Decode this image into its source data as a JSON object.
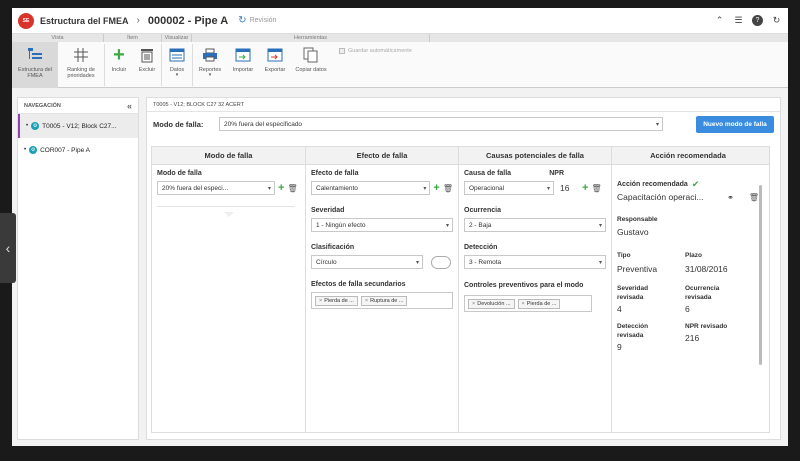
{
  "header": {
    "app_title": "Estructura del FMEA",
    "doc_title": "000002 - Pipe A",
    "revision_label": "Revisión"
  },
  "ribbon": {
    "groups": [
      "Vista",
      "Ítem",
      "Visualizar",
      "Herramientas"
    ],
    "buttons": {
      "estructura": "Estructura del FMEA",
      "ranking": "Ranking de prioridades",
      "incluir": "Incluir",
      "excluir": "Excluir",
      "datos": "Datos",
      "reportes": "Reportes",
      "importar": "Importar",
      "exportar": "Exportar",
      "copiar": "Copiar datos"
    },
    "autosave_label": "Guardar automáticamente"
  },
  "nav": {
    "title": "NAVEGACIÓN",
    "items": [
      {
        "label": "T0005 - V12; Block C27..."
      },
      {
        "label": "COR007 - Pipe A"
      }
    ]
  },
  "main": {
    "breadcrumb": "T0005 - V12; BLOCK C27 32 ACERT",
    "mode_label": "Modo de falla:",
    "mode_value": "20% fuera del especificado",
    "new_mode_button": "Nuevo modo de falla"
  },
  "grid": {
    "headers": [
      "Modo de falla",
      "Efecto de falla",
      "Causas potenciales de falla",
      "Acción recomendada"
    ],
    "modo": {
      "label": "Modo de falla",
      "value": "20% fuera del especi..."
    },
    "efecto": {
      "label": "Efecto de falla",
      "value": "Calentamiento",
      "severidad_label": "Severidad",
      "severidad_value": "1 - Ningún efecto",
      "clasificacion_label": "Clasificación",
      "clasificacion_value": "Círculo",
      "secundarios_label": "Efectos de falla secundarios",
      "tags": [
        "Pierda de ...",
        "Ruptura de ..."
      ]
    },
    "causas": {
      "label": "Causa de falla",
      "value": "Operacional",
      "npr_label": "NPR",
      "npr_value": "16",
      "ocurrencia_label": "Ocurrencia",
      "ocurrencia_value": "2 - Baja",
      "deteccion_label": "Detección",
      "deteccion_value": "3 - Remota",
      "controles_label": "Controles preventivos para el modo",
      "tags": [
        "Devolución ...",
        "Pierda de ..."
      ]
    },
    "accion": {
      "label": "Acción recomendada",
      "value": "Capacitación operaci...",
      "responsable_label": "Responsable",
      "responsable_value": "Gustavo",
      "tipo_label": "Tipo",
      "tipo_value": "Preventiva",
      "plazo_label": "Plazo",
      "plazo_value": "31/08/2016",
      "sev_rev_label": "Severidad revisada",
      "sev_rev_value": "4",
      "ocu_rev_label": "Ocurrencia revisada",
      "ocu_rev_value": "6",
      "det_rev_label": "Detección revisada",
      "det_rev_value": "9",
      "npr_rev_label": "NPR revisado",
      "npr_rev_value": "216"
    }
  }
}
